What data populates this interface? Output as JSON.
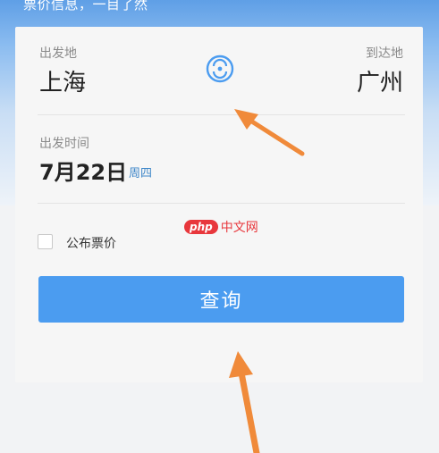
{
  "banner": {
    "text": "票价信息，一目了然"
  },
  "route": {
    "from_label": "出发地",
    "from_city": "上海",
    "to_label": "到达地",
    "to_city": "广州",
    "swap_icon": "swap-station-icon"
  },
  "departure": {
    "label": "出发时间",
    "date": "7月22日",
    "weekday": "周四"
  },
  "publish_price": {
    "label": "公布票价",
    "checked": false
  },
  "search_button": {
    "label": "查询"
  },
  "watermark": {
    "logo": "php",
    "text": "中文网"
  },
  "colors": {
    "accent": "#4b9cf0",
    "weekday": "#3d86c8",
    "arrow": "#f08a3a"
  }
}
